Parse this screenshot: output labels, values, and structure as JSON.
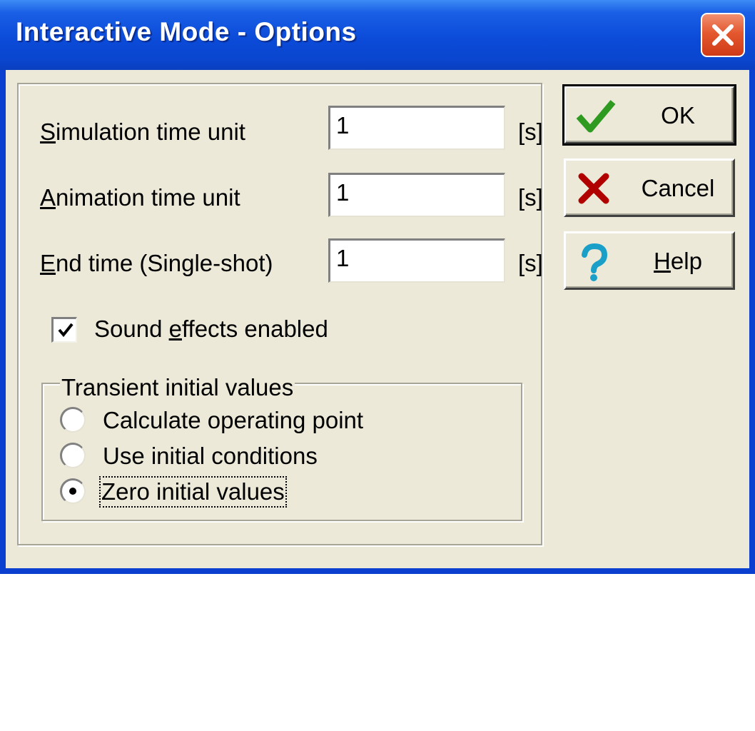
{
  "window": {
    "title": "Interactive Mode - Options",
    "close_icon": "close-icon"
  },
  "fields": {
    "sim_label_mn": "S",
    "sim_label_rest": "imulation time unit",
    "sim_value": "1",
    "sim_unit": "[s]",
    "anim_label_mn": "A",
    "anim_label_rest": "nimation time unit",
    "anim_value": "1",
    "anim_unit": "[s]",
    "end_label_mn": "E",
    "end_label_rest": "nd time (Single-shot)",
    "end_value": "1",
    "end_unit": "[s]"
  },
  "sound": {
    "checked": true,
    "label_pre": "Sound ",
    "label_mn": "e",
    "label_post": "ffects enabled"
  },
  "transient": {
    "legend": "Transient initial values",
    "options": [
      {
        "label": "Calculate operating point",
        "selected": false
      },
      {
        "label": "Use initial conditions",
        "selected": false
      },
      {
        "label": "Zero initial values",
        "selected": true
      }
    ]
  },
  "buttons": {
    "ok": {
      "label": "OK",
      "icon": "checkmark-icon"
    },
    "cancel": {
      "label": "Cancel",
      "icon": "x-icon"
    },
    "help": {
      "label_mn": "H",
      "label_rest": "elp",
      "icon": "question-icon"
    }
  },
  "colors": {
    "title_bar": "#0a46cf",
    "dialog_bg": "#ece9d8",
    "ok_check": "#2e9a20",
    "cancel_x": "#b00000",
    "help_q": "#1aa0c8"
  }
}
